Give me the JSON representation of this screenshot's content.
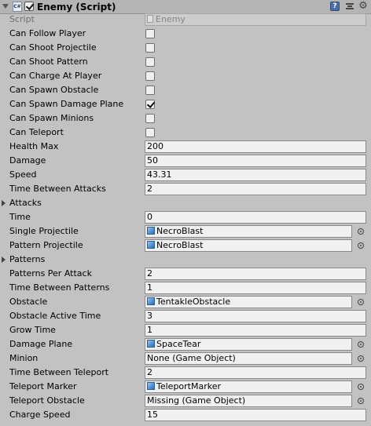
{
  "component": {
    "title": "Enemy (Script)"
  },
  "script_row": {
    "label": "Script",
    "value": "Enemy"
  },
  "toggles": [
    {
      "label": "Can Follow Player",
      "checked": false
    },
    {
      "label": "Can Shoot Projectile",
      "checked": false
    },
    {
      "label": "Can Shoot Pattern",
      "checked": false
    },
    {
      "label": "Can Charge At Player",
      "checked": false
    },
    {
      "label": "Can Spawn Obstacle",
      "checked": false
    },
    {
      "label": "Can Spawn Damage Plane",
      "checked": true
    },
    {
      "label": "Can Spawn Minions",
      "checked": false
    },
    {
      "label": "Can Teleport",
      "checked": false
    }
  ],
  "fields": {
    "health_max": {
      "label": "Health Max",
      "value": "200"
    },
    "damage": {
      "label": "Damage",
      "value": "50"
    },
    "speed": {
      "label": "Speed",
      "value": "43.31"
    },
    "time_between_attacks": {
      "label": "Time Between Attacks",
      "value": "2"
    },
    "attacks": {
      "label": "Attacks"
    },
    "time": {
      "label": "Time",
      "value": "0"
    },
    "single_projectile": {
      "label": "Single Projectile",
      "value": "NecroBlast"
    },
    "pattern_projectile": {
      "label": "Pattern Projectile",
      "value": "NecroBlast"
    },
    "patterns": {
      "label": "Patterns"
    },
    "patterns_per_attack": {
      "label": "Patterns Per Attack",
      "value": "2"
    },
    "time_between_patterns": {
      "label": "Time Between Patterns",
      "value": "1"
    },
    "obstacle": {
      "label": "Obstacle",
      "value": "TentakleObstacle"
    },
    "obstacle_active_time": {
      "label": "Obstacle Active Time",
      "value": "3"
    },
    "grow_time": {
      "label": "Grow Time",
      "value": "1"
    },
    "damage_plane": {
      "label": "Damage Plane",
      "value": "SpaceTear"
    },
    "minion": {
      "label": "Minion",
      "value": "None (Game Object)"
    },
    "time_between_teleport": {
      "label": "Time Between Teleport",
      "value": "2"
    },
    "teleport_marker": {
      "label": "Teleport Marker",
      "value": "TeleportMarker"
    },
    "teleport_obstacle": {
      "label": "Teleport Obstacle",
      "value": "Missing (Game Object)"
    },
    "charge_speed": {
      "label": "Charge Speed",
      "value": "15"
    }
  },
  "icons": {
    "header": [
      "fold-arrow-icon",
      "script-icon",
      "enabled-checkbox",
      "help-icon",
      "preset-icon",
      "gear-icon"
    ],
    "object_field": "cube-icon",
    "object_picker": "object-picker-icon"
  },
  "colors": {
    "panel_bg": "#c2c2c2",
    "header_bg": "#b4b4b4",
    "field_bg": "#f0f0f0",
    "cube_blue": "#4f8fd6"
  }
}
